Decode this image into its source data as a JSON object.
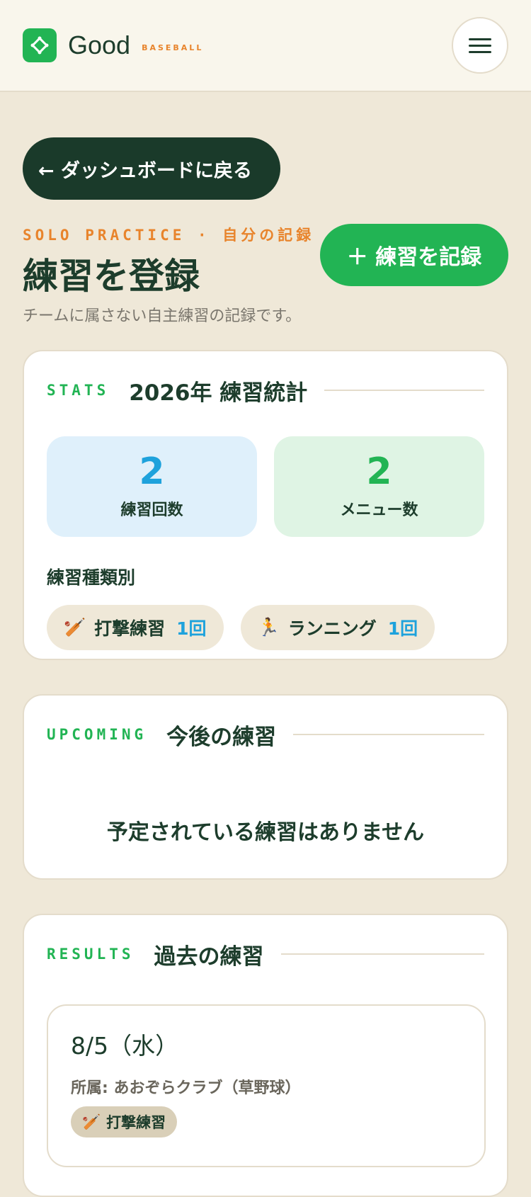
{
  "header": {
    "brand": "Good",
    "brand_sub": "BASEBALL",
    "logo_icon": "diamond-icon",
    "menu_icon": "hamburger-icon"
  },
  "nav": {
    "back_label": "← ダッシュボードに戻る"
  },
  "page": {
    "eyebrow": "SOLO PRACTICE · 自分の記録",
    "title": "練習を登録",
    "subtitle": "チームに属さない自主練習の記録です。",
    "record_button": "＋ 練習を記録"
  },
  "stats": {
    "kicker": "STATS",
    "title": "2026年 練習統計",
    "practice_count": "2",
    "practice_count_label": "練習回数",
    "menu_count": "2",
    "menu_count_label": "メニュー数",
    "type_heading": "練習種類別",
    "types": [
      {
        "emoji": "🏏",
        "name": "打撃練習",
        "count": "1回"
      },
      {
        "emoji": "🏃",
        "name": "ランニング",
        "count": "1回"
      }
    ]
  },
  "upcoming": {
    "kicker": "UPCOMING",
    "title": "今後の練習",
    "empty": "予定されている練習はありません"
  },
  "results": {
    "kicker": "RESULTS",
    "title": "過去の練習",
    "entries": [
      {
        "date": "8/5（水）",
        "affiliation": "所属: あおぞらクラブ（草野球）",
        "tag_emoji": "🏏",
        "tag": "打撃練習"
      }
    ]
  },
  "colors": {
    "accent_green": "#22b454",
    "accent_orange": "#e8842c",
    "accent_blue": "#1ea2dc",
    "dark_green": "#1a3a2a",
    "background": "#efe8d8"
  }
}
